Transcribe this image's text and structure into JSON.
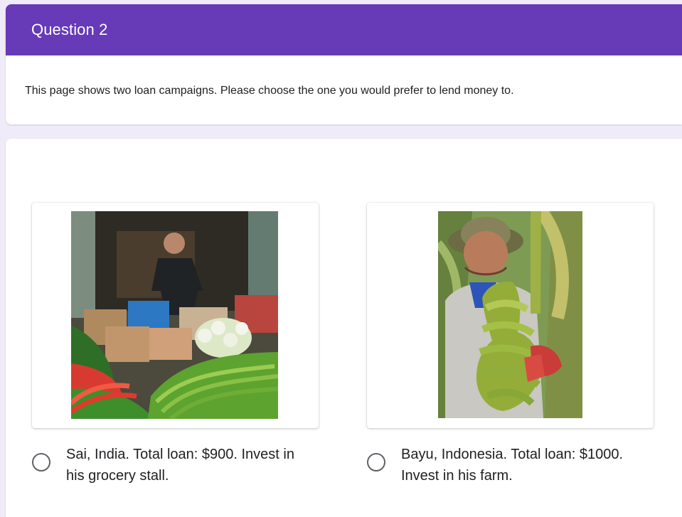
{
  "question": {
    "title": "Question 2",
    "description": "This page shows two loan campaigns. Please choose the one you would prefer to lend money to."
  },
  "options": [
    {
      "label": "Sai, India. Total loan: $900. Invest in his grocery stall."
    },
    {
      "label": "Bayu, Indonesia. Total loan: $1000. Invest in his farm."
    }
  ],
  "colors": {
    "accent": "#673ab7",
    "background": "#f0ebf8",
    "card": "#ffffff",
    "text": "#202124",
    "radio": "#5f6368"
  }
}
